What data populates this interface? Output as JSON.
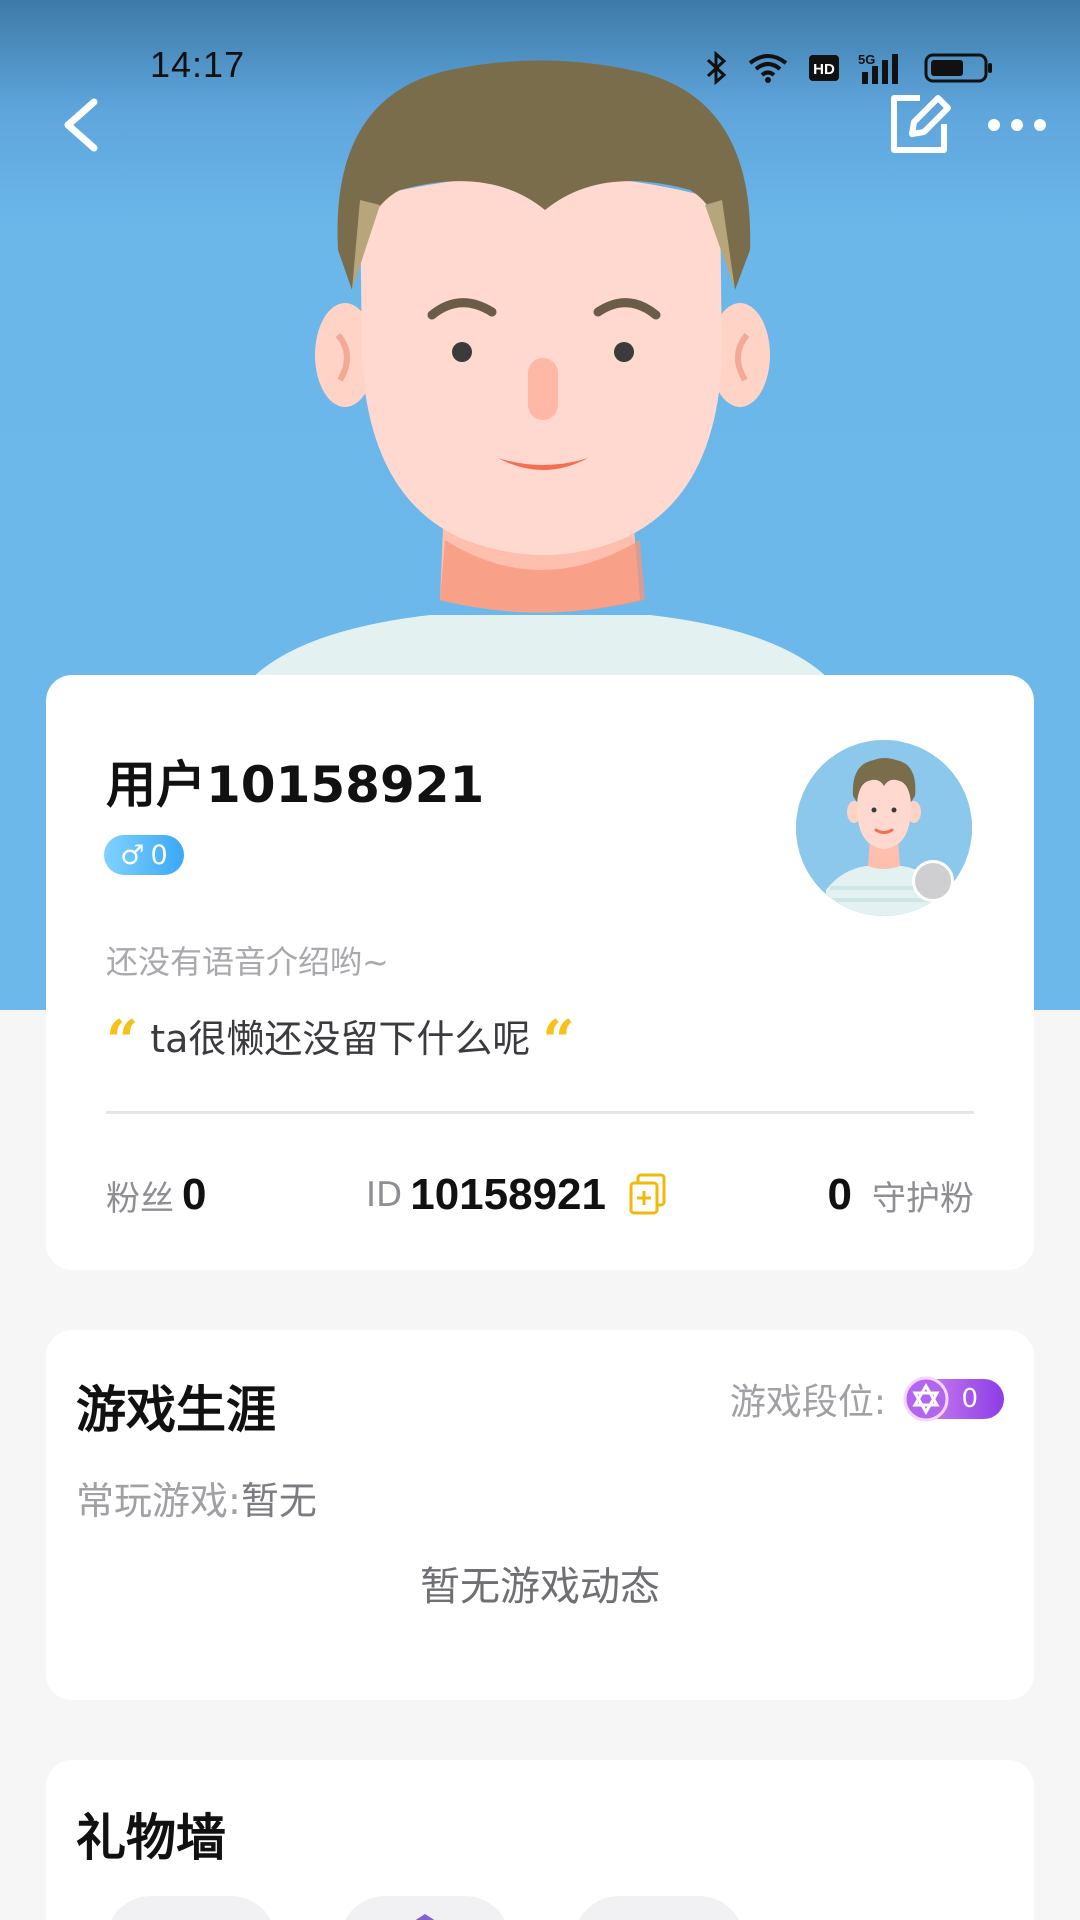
{
  "status_bar": {
    "time": "14:17",
    "icons": [
      "bluetooth-icon",
      "wifi-icon",
      "hd-icon",
      "signal-5g-icon",
      "battery-icon"
    ],
    "hd_label": "HD",
    "network_label": "5G"
  },
  "nav": {
    "back_icon": "chevron-left-icon",
    "edit_icon": "edit-icon",
    "more_icon": "more-dots-icon"
  },
  "profile": {
    "username": "用户10158921",
    "gender_symbol": "♂",
    "gender_level": "0",
    "voice_intro": "还没有语音介绍哟~",
    "bio": "ta很懒还没留下什么呢",
    "quote_open": "“",
    "quote_close": "“",
    "fans_label": "粉丝",
    "fans_count": "0",
    "id_label": "ID",
    "id_value": "10158921",
    "guard_count": "0",
    "guard_label": "守护粉"
  },
  "career": {
    "title": "游戏生涯",
    "rank_label": "游戏段位:",
    "rank_value": "0",
    "fav_label": "常玩游戏:",
    "fav_value": "暂无",
    "empty_text": "暂无游戏动态"
  },
  "gift_wall": {
    "title": "礼物墙"
  },
  "colors": {
    "hero_blue": "#6cb8ea",
    "quote_yellow": "#f6c11b",
    "gender_blue": "#3aa8f5",
    "rank_purple": "#8d3ce6"
  }
}
